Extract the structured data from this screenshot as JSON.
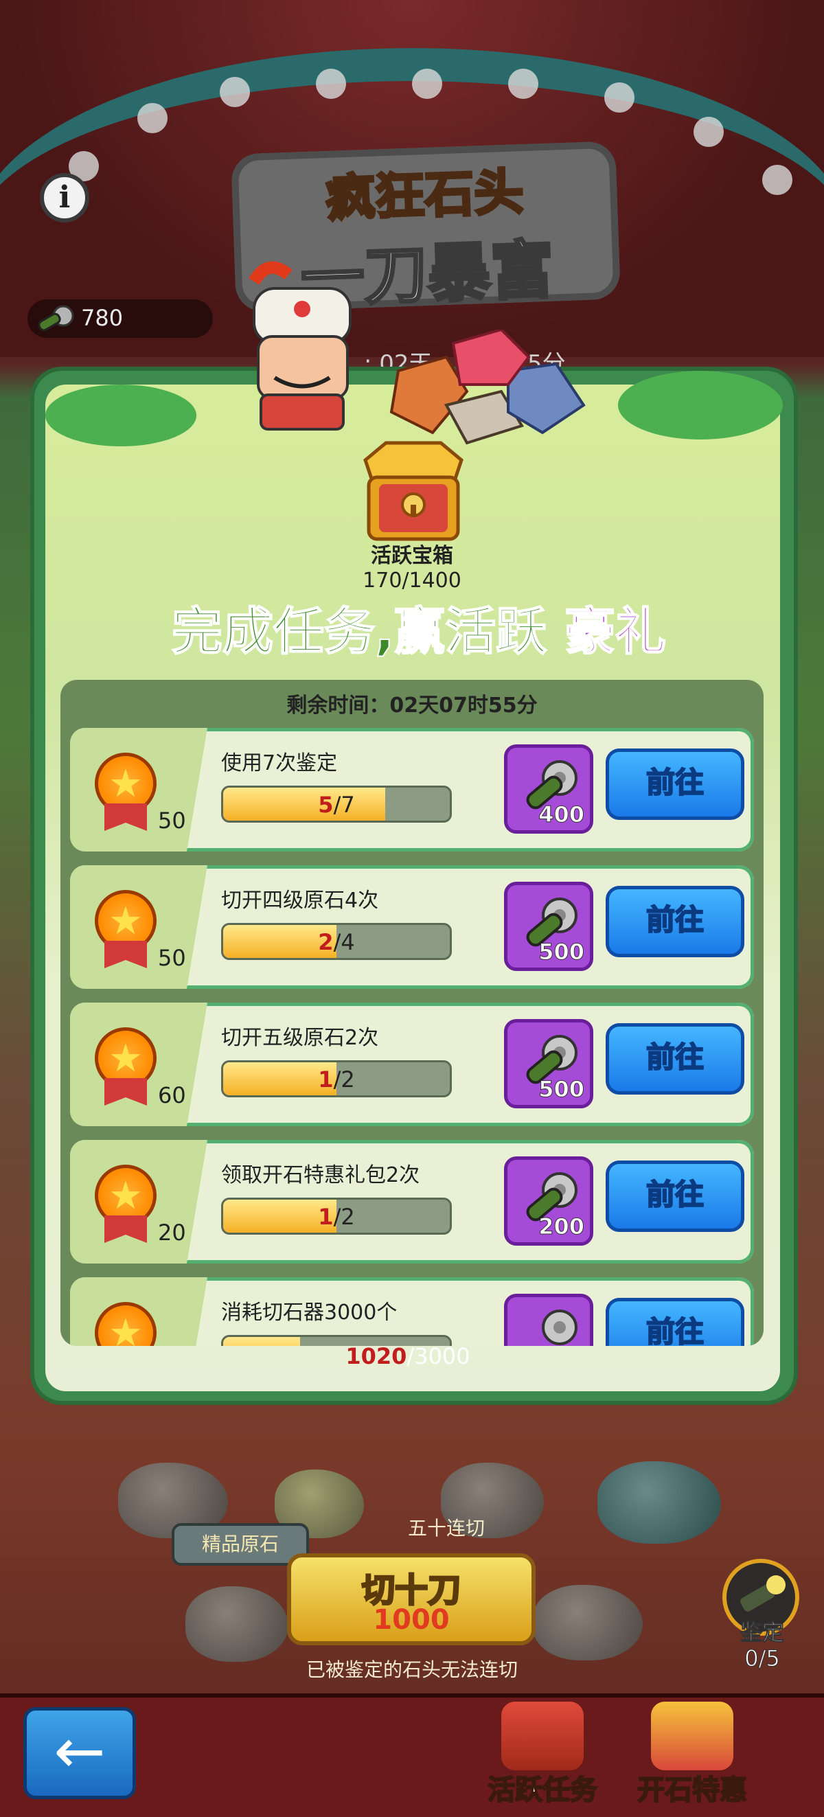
{
  "header": {
    "title_line1": "疯狂石头",
    "title_line2": "一刀暴富",
    "currency_value": "780",
    "behind_timer_fragment": ": 02天",
    "behind_timer_fragment2": "5分"
  },
  "panel": {
    "chest_label": "活跃宝箱",
    "chest_progress": "170/1400",
    "headline_a": "完成任务,赢活跃",
    "headline_b": "豪礼",
    "timer_text": "剩余时间：02天07时55分"
  },
  "tasks": [
    {
      "name": "使用7次鉴定",
      "points": "50",
      "current": "5",
      "total": "/7",
      "progress": 0.714,
      "reward": "400",
      "go": "前往"
    },
    {
      "name": "切开四级原石4次",
      "points": "50",
      "current": "2",
      "total": "/4",
      "progress": 0.5,
      "reward": "500",
      "go": "前往"
    },
    {
      "name": "切开五级原石2次",
      "points": "60",
      "current": "1",
      "total": "/2",
      "progress": 0.5,
      "reward": "500",
      "go": "前往"
    },
    {
      "name": "领取开石特惠礼包2次",
      "points": "20",
      "current": "1",
      "total": "/2",
      "progress": 0.5,
      "reward": "200",
      "go": "前往"
    },
    {
      "name": "消耗切石器3000个",
      "points": "",
      "current": "1020",
      "total": "/3000",
      "progress": 0.34,
      "reward": "",
      "go": "前往"
    }
  ],
  "game": {
    "fifty_cut": "五十连切",
    "premium_tag": "精品原石",
    "cut_button_label": "切十刀",
    "cut_button_cost": "1000",
    "cut_note": "已被鉴定的石头无法连切",
    "appraise_label": "鉴定",
    "appraise_count": "0/5"
  },
  "bottom": {
    "back_icon": "←",
    "tab1": "活跃任务",
    "tab2": "开石特惠"
  },
  "colors": {
    "panel": "#3c8a4e",
    "go_button": "#1a7ae8",
    "reward_bg": "#a64ad8",
    "progress_current": "#c01e1e"
  }
}
